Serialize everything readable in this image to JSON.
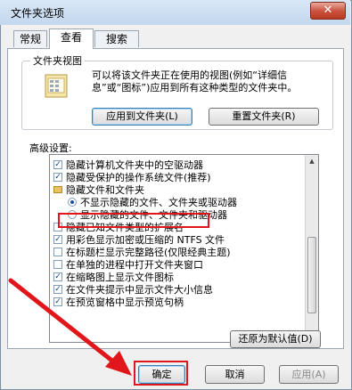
{
  "window": {
    "title": "文件夹选项",
    "close_label": "✕"
  },
  "tabs": [
    {
      "label": "常规",
      "active": false
    },
    {
      "label": "查看",
      "active": true
    },
    {
      "label": "搜索",
      "active": false
    }
  ],
  "folder_views": {
    "title": "文件夹视图",
    "description": "可以将该文件夹正在使用的视图(例如“详细信息”或“图标”)应用到所有这种类型的文件夹中。",
    "apply_button": "应用到文件夹(L)",
    "reset_button": "重置文件夹(R)"
  },
  "advanced": {
    "label": "高级设置:",
    "items": [
      {
        "type": "checkbox",
        "checked": true,
        "label": "隐藏计算机文件夹中的空驱动器"
      },
      {
        "type": "checkbox",
        "checked": true,
        "label": "隐藏受保护的操作系统文件(推荐)"
      },
      {
        "type": "folder",
        "label": "隐藏文件和文件夹"
      },
      {
        "type": "radio",
        "selected": true,
        "label": "不显示隐藏的文件、文件夹或驱动器"
      },
      {
        "type": "radio",
        "selected": false,
        "label": "显示隐藏的文件、文件夹和驱动器"
      },
      {
        "type": "checkbox",
        "checked": false,
        "label": "隐藏已知文件类型的扩展名"
      },
      {
        "type": "checkbox",
        "checked": true,
        "label": "用彩色显示加密或压缩的 NTFS 文件"
      },
      {
        "type": "checkbox",
        "checked": false,
        "label": "在标题栏显示完整路径(仅限经典主题)"
      },
      {
        "type": "checkbox",
        "checked": false,
        "label": "在单独的进程中打开文件夹窗口"
      },
      {
        "type": "checkbox",
        "checked": true,
        "label": "在缩略图上显示文件图标"
      },
      {
        "type": "checkbox",
        "checked": true,
        "label": "在文件夹提示中显示文件大小信息"
      },
      {
        "type": "checkbox",
        "checked": true,
        "label": "在预览窗格中显示预览句柄"
      }
    ]
  },
  "restore_button": "还原为默认值(D)",
  "footer": {
    "ok": "确定",
    "cancel": "取消",
    "apply": "应用(A)"
  },
  "colors": {
    "highlight": "#e0161b"
  }
}
